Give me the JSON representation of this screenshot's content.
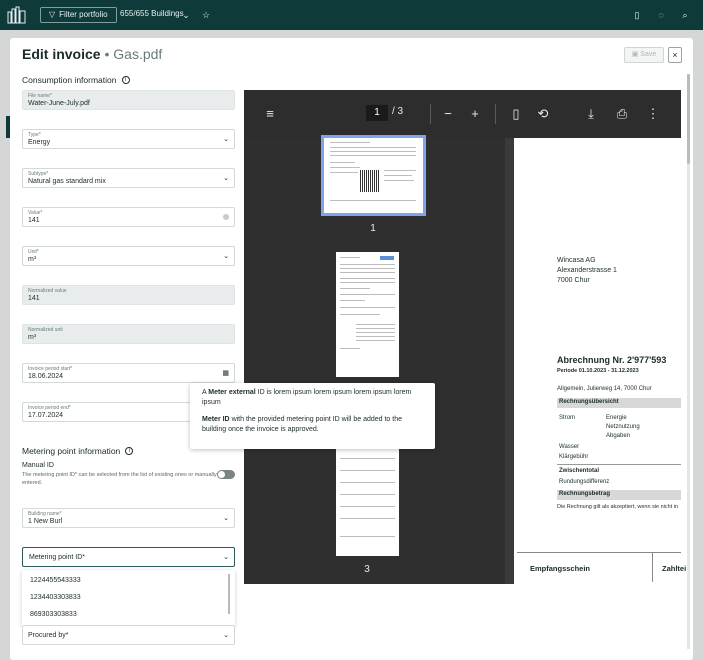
{
  "topbar": {
    "filter_label": "Filter portfolio",
    "buildings_label": "655/655 Buildings"
  },
  "modal": {
    "title": "Edit invoice",
    "subtitle": "Gas.pdf",
    "save_label": "Save",
    "close_label": "×"
  },
  "consumption": {
    "title": "Consumption information",
    "fields": [
      {
        "label": "File name*",
        "value": "Water-June-July.pdf"
      },
      {
        "label": "Type*",
        "value": "Energy"
      },
      {
        "label": "Subtype*",
        "value": "Natural gas standard mix"
      },
      {
        "label": "Value*",
        "value": "141"
      },
      {
        "label": "Unit*",
        "value": "m³"
      },
      {
        "label": "Normalized value",
        "value": "141"
      },
      {
        "label": "Normalized unit",
        "value": "m³"
      },
      {
        "label": "Invoice period start*",
        "value": "18.06.2024"
      },
      {
        "label": "Invoice period end*",
        "value": "17.07.2024"
      }
    ]
  },
  "metering": {
    "title": "Metering point information",
    "manual_id_label": "Manual ID",
    "manual_id_desc": "The metering point ID* can be selected from the list of existing ones or manually entered.",
    "building_label": "Building name*",
    "building_value": "1 New Burl",
    "metering_point_placeholder": "Metering point ID*",
    "options": [
      "1224455543333",
      "1234403303833",
      "869303303833"
    ],
    "procured_label": "Procured by*"
  },
  "tooltip": {
    "line1_pre": "A ",
    "line1_bold": "Meter external",
    "line1_post": " ID is lorem ipsum lorem ipsum lorem ipsum lorem ipsum",
    "line2_bold": "Meter ID",
    "line2_post": " with the provided metering point ID will be added to the building once the invoice is approved."
  },
  "pdf": {
    "current_page": "1",
    "page_of": "/  3",
    "thumb_labels": [
      "1",
      "3"
    ],
    "page": {
      "company": "Wincasa AG",
      "street": "Alexanderstrasse 1",
      "city": "7000 Chur",
      "heading": "Abrechnung Nr. 2'977'593",
      "period": "Periode 01.10.2023 - 31.12.2023",
      "address": "Allgemein, Julierweg 14, 7000 Chur",
      "overview": "Rechnungsübersicht",
      "strom": "Strom",
      "energie": "Energie",
      "netznutzung": "Netznutzung",
      "abgaben": "Abgaben",
      "wasser": "Wasser",
      "klaergebuehr": "Klärgebühr",
      "zwischentotal": "Zwischentotal",
      "rundung": "Rundungsdifferenz",
      "betrag": "Rechnungsbetrag",
      "accept": "Die Rechnung gilt als akzeptiert, wenn sie nicht in",
      "empfang": "Empfangsschein",
      "zahlteil": "Zahltei"
    }
  }
}
